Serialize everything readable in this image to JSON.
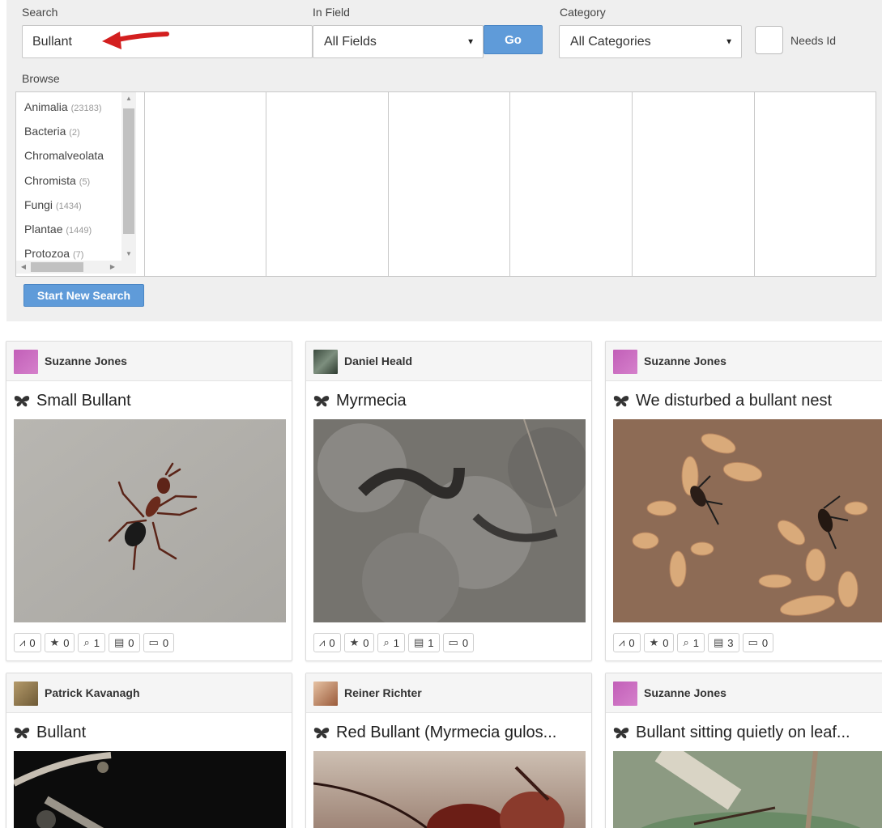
{
  "search": {
    "search_label": "Search",
    "search_value": "Bullant",
    "field_label": "In Field",
    "field_value": "All Fields",
    "go_label": "Go",
    "category_label": "Category",
    "category_value": "All Categories",
    "needs_id_label": "Needs Id",
    "browse_label": "Browse",
    "new_search_label": "Start New Search"
  },
  "kingdoms": [
    {
      "name": "Animalia",
      "count": "(23183)"
    },
    {
      "name": "Bacteria",
      "count": "(2)"
    },
    {
      "name": "Chromalveolata",
      "count": ""
    },
    {
      "name": "Chromista",
      "count": "(5)"
    },
    {
      "name": "Fungi",
      "count": "(1434)"
    },
    {
      "name": "Plantae",
      "count": "(1449)"
    },
    {
      "name": "Protozoa",
      "count": "(7)"
    }
  ],
  "colors": {
    "accent_button": "#5f9bd9",
    "panel_bg": "#efefef",
    "arrow": "#e02020"
  },
  "cards": [
    {
      "user": "Suzanne Jones",
      "title": "Small Bullant",
      "stats": {
        "trend": "0",
        "fav": "0",
        "ids": "1",
        "notes": "0",
        "comments": "0"
      }
    },
    {
      "user": "Daniel Heald",
      "title": "Myrmecia",
      "stats": {
        "trend": "0",
        "fav": "0",
        "ids": "1",
        "notes": "1",
        "comments": "0"
      }
    },
    {
      "user": "Suzanne Jones",
      "title": "We disturbed a bullant nest",
      "stats": {
        "trend": "0",
        "fav": "0",
        "ids": "1",
        "notes": "3",
        "comments": "0"
      }
    },
    {
      "user": "Patrick Kavanagh",
      "title": "Bullant"
    },
    {
      "user": "Reiner Richter",
      "title": "Red Bullant (Myrmecia gulos..."
    },
    {
      "user": "Suzanne Jones",
      "title": "Bullant sitting quietly on leaf..."
    }
  ],
  "icons": {
    "title_icon": "butterfly-icon",
    "stat_icons": [
      "trend-icon",
      "star-icon",
      "identify-icon",
      "notes-icon",
      "comment-icon"
    ]
  }
}
